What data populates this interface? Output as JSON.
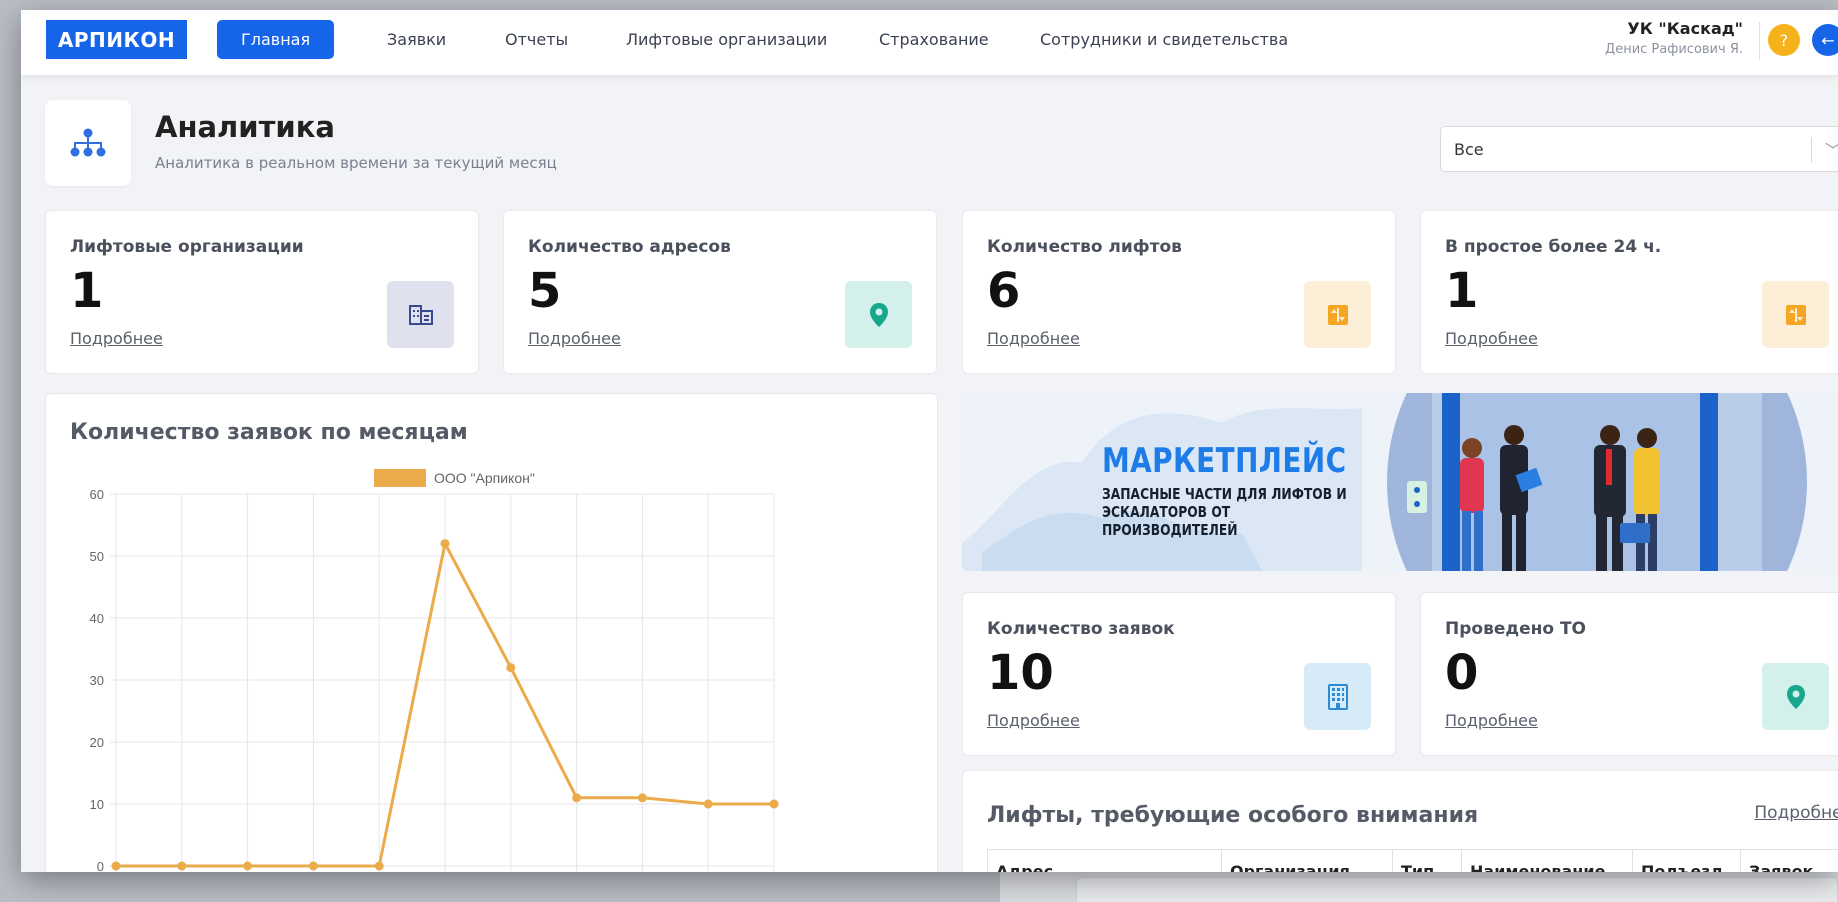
{
  "app": {
    "logo": "АРПИКОН",
    "nav": [
      {
        "label": "Главная",
        "active": true
      },
      {
        "label": "Заявки",
        "active": false
      },
      {
        "label": "Отчеты",
        "active": false
      },
      {
        "label": "Лифтовые организации",
        "active": false
      },
      {
        "label": "Страхование",
        "active": false
      },
      {
        "label": "Сотрудники и свидетельства",
        "active": false
      }
    ],
    "user": {
      "org": "УК \"Каскад\"",
      "name": "Денис Рафисович Я."
    },
    "help_label": "?",
    "logout_icon": "←"
  },
  "page": {
    "title": "Аналитика",
    "subtitle": "Аналитика в реальном времени за текущий месяц",
    "filter_value": "Все"
  },
  "stats": [
    {
      "label": "Лифтовые организации",
      "value": "1",
      "link": "Подробнее",
      "icon": "building-icon",
      "icon_bg": "#dfe1ee",
      "icon_color": "#3a4a8c"
    },
    {
      "label": "Количество адресов",
      "value": "5",
      "link": "Подробнее",
      "icon": "map-pin-icon",
      "icon_bg": "#d3f0ea",
      "icon_color": "#16a78c"
    },
    {
      "label": "Количество лифтов",
      "value": "6",
      "link": "Подробнее",
      "icon": "elevator-icon",
      "icon_bg": "#fdeed7",
      "icon_color": "#f5a623"
    },
    {
      "label": "В простое более 24 ч.",
      "value": "1",
      "link": "Подробнее",
      "icon": "elevator-icon",
      "icon_bg": "#fdeed7",
      "icon_color": "#f5a623"
    },
    {
      "label": "Количество заявок",
      "value": "10",
      "link": "Подробнее",
      "icon": "office-building-icon",
      "icon_bg": "#d6eaf8",
      "icon_color": "#2a8bd6"
    },
    {
      "label": "Проведено ТО",
      "value": "0",
      "link": "Подробнее",
      "icon": "map-pin-icon",
      "icon_bg": "#d3f0ea",
      "icon_color": "#16a78c"
    }
  ],
  "chart_card": {
    "title": "Количество заявок по месяцам"
  },
  "chart_data": {
    "type": "line",
    "title": "",
    "xlabel": "",
    "ylabel": "",
    "ylim": [
      0,
      60
    ],
    "yticks": [
      0,
      10,
      20,
      30,
      40,
      50,
      60
    ],
    "grid": true,
    "legend_position": "top",
    "series": [
      {
        "name": "ООО \"Арпикон\"",
        "color": "#ecab4a",
        "values": [
          0,
          0,
          0,
          0,
          0,
          52,
          32,
          11,
          11,
          10,
          10
        ]
      }
    ]
  },
  "banner": {
    "title": "МАРКЕТПЛЕЙС",
    "subtitle_line1": "ЗАПАСНЫЕ ЧАСТИ ДЛЯ ЛИФТОВ И",
    "subtitle_line2": "ЭСКАЛАТОРОВ ОТ ПРОИЗВОДИТЕЛЕЙ"
  },
  "attention": {
    "title": "Лифты, требующие особого внимания",
    "link": "Подробнее",
    "columns": [
      "Адрес",
      "Организация",
      "Тип",
      "Наименование",
      "Подъезд",
      "Заявок"
    ]
  }
}
